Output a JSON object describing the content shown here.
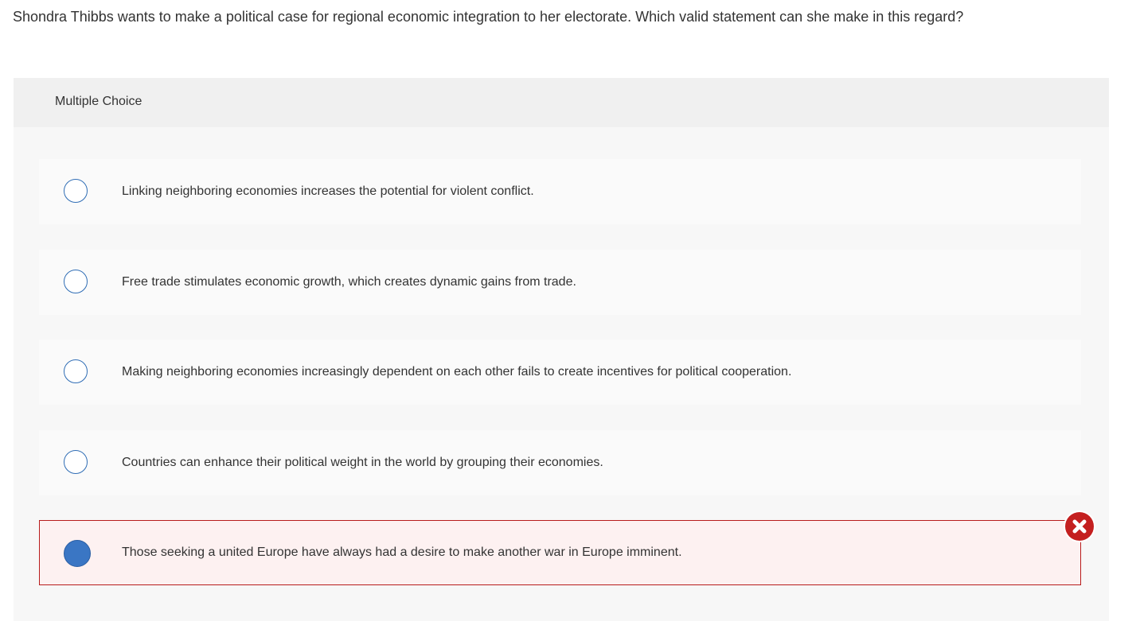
{
  "question": {
    "text": "Shondra Thibbs wants to make a political case for regional economic integration to her electorate. Which valid statement can she make in this regard?"
  },
  "multiple_choice": {
    "header": "Multiple Choice",
    "selected_index": 4,
    "selected_result": "incorrect",
    "choices": [
      {
        "label": "Linking neighboring economies increases the potential for violent conflict.",
        "selected": false
      },
      {
        "label": "Free trade stimulates economic growth, which creates dynamic gains from trade.",
        "selected": false
      },
      {
        "label": "Making neighboring economies increasingly dependent on each other fails to create incentives for political cooperation.",
        "selected": false
      },
      {
        "label": "Countries can enhance their political weight in the world by grouping their economies.",
        "selected": false
      },
      {
        "label": "Those seeking a united Europe have always had a desire to make another war in Europe imminent.",
        "selected": true
      }
    ]
  },
  "icons": {
    "radio": "radio-button-icon",
    "result": "incorrect-x-icon"
  },
  "colors": {
    "accent_blue": "#3a76c4",
    "error_red": "#c41f1f",
    "selected_bg": "#fdf1f1"
  }
}
